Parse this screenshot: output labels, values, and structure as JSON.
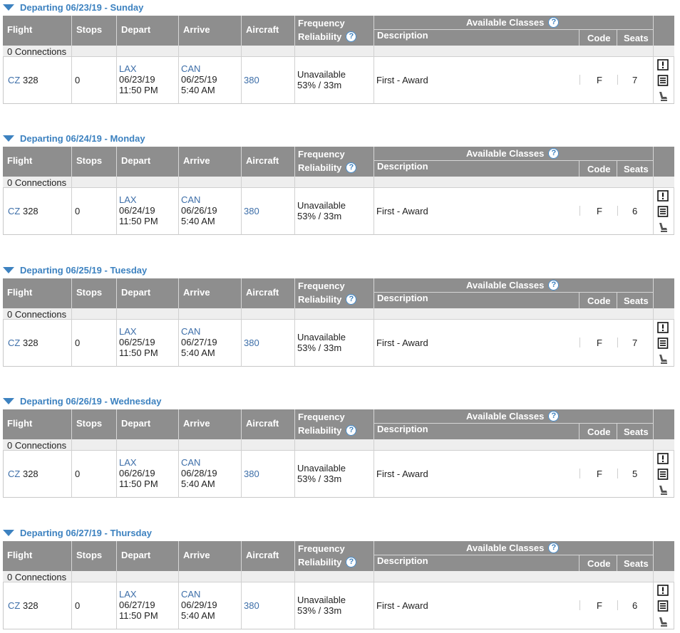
{
  "columns": {
    "flight": "Flight",
    "stops": "Stops",
    "depart": "Depart",
    "arrive": "Arrive",
    "aircraft": "Aircraft",
    "frequency": "Frequency",
    "reliability": "Reliability",
    "available_classes": "Available Classes",
    "description": "Description",
    "code": "Code",
    "seats": "Seats"
  },
  "help_glyph": "?",
  "icon_names": [
    "alert-icon",
    "notes-icon",
    "seat-icon"
  ],
  "accent_color": "#3d82c0",
  "header_bg": "#8e8e8e",
  "days": [
    {
      "header": "Departing 06/23/19 - Sunday",
      "connections": "0 Connections",
      "flight_airline": "CZ",
      "flight_number": "328",
      "stops": "0",
      "depart_airport": "LAX",
      "depart_date": "06/23/19",
      "depart_time": "11:50 PM",
      "arrive_airport": "CAN",
      "arrive_date": "06/25/19",
      "arrive_time": "5:40 AM",
      "aircraft": "380",
      "frequency": "Unavailable",
      "reliability": "53% / 33m",
      "description": "First - Award",
      "code": "F",
      "seats": "7"
    },
    {
      "header": "Departing 06/24/19 - Monday",
      "connections": "0 Connections",
      "flight_airline": "CZ",
      "flight_number": "328",
      "stops": "0",
      "depart_airport": "LAX",
      "depart_date": "06/24/19",
      "depart_time": "11:50 PM",
      "arrive_airport": "CAN",
      "arrive_date": "06/26/19",
      "arrive_time": "5:40 AM",
      "aircraft": "380",
      "frequency": "Unavailable",
      "reliability": "53% / 33m",
      "description": "First - Award",
      "code": "F",
      "seats": "6"
    },
    {
      "header": "Departing 06/25/19 - Tuesday",
      "connections": "0 Connections",
      "flight_airline": "CZ",
      "flight_number": "328",
      "stops": "0",
      "depart_airport": "LAX",
      "depart_date": "06/25/19",
      "depart_time": "11:50 PM",
      "arrive_airport": "CAN",
      "arrive_date": "06/27/19",
      "arrive_time": "5:40 AM",
      "aircraft": "380",
      "frequency": "Unavailable",
      "reliability": "53% / 33m",
      "description": "First - Award",
      "code": "F",
      "seats": "7"
    },
    {
      "header": "Departing 06/26/19 - Wednesday",
      "connections": "0 Connections",
      "flight_airline": "CZ",
      "flight_number": "328",
      "stops": "0",
      "depart_airport": "LAX",
      "depart_date": "06/26/19",
      "depart_time": "11:50 PM",
      "arrive_airport": "CAN",
      "arrive_date": "06/28/19",
      "arrive_time": "5:40 AM",
      "aircraft": "380",
      "frequency": "Unavailable",
      "reliability": "53% / 33m",
      "description": "First - Award",
      "code": "F",
      "seats": "5"
    },
    {
      "header": "Departing 06/27/19 - Thursday",
      "connections": "0 Connections",
      "flight_airline": "CZ",
      "flight_number": "328",
      "stops": "0",
      "depart_airport": "LAX",
      "depart_date": "06/27/19",
      "depart_time": "11:50 PM",
      "arrive_airport": "CAN",
      "arrive_date": "06/29/19",
      "arrive_time": "5:40 AM",
      "aircraft": "380",
      "frequency": "Unavailable",
      "reliability": "53% / 33m",
      "description": "First - Award",
      "code": "F",
      "seats": "6"
    }
  ]
}
